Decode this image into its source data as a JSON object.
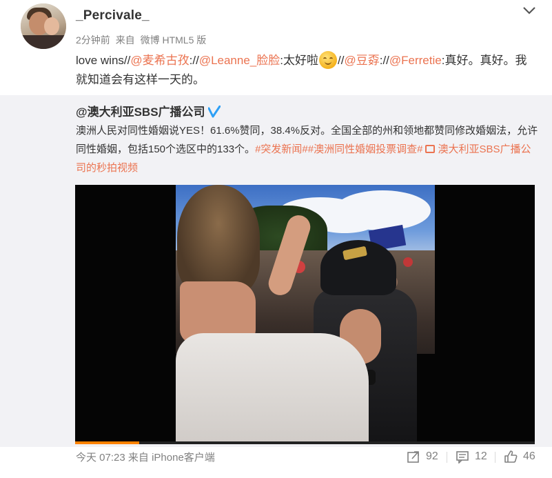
{
  "post": {
    "username": "_Percivale_",
    "meta": {
      "time": "2分钟前",
      "from_label": "来自",
      "source": "微博 HTML5 版"
    },
    "text": {
      "prefix": "love wins//",
      "mention1": "@麦希古孜",
      "sep1": "://",
      "mention2": "@Leanne_脸脸",
      "after2": ":太好啦",
      "sep2": "//",
      "mention3": "@豆孬",
      "sep3": "://",
      "mention4": "@Ferretie",
      "suffix": ":真好。真好。我就知道会有这样一天的。"
    }
  },
  "repost": {
    "author": "@澳大利亚SBS广播公司",
    "text_main": "澳洲人民对同性婚姻说YES！61.6%赞同，38.4%反对。全国全部的州和领地都赞同修改婚姻法，允许同性婚姻，包括150个选区中的133个。",
    "tag1": "#突发新闻#",
    "tag2": "#澳洲同性婚姻投票调查#",
    "video_link": "澳大利亚SBS广播公司的秒拍视频",
    "video": {
      "progress": 0.14
    },
    "footer": {
      "time": "今天 07:23",
      "from_label": "来自",
      "source": "iPhone客户端"
    },
    "stats": {
      "forward": "92",
      "comment": "12",
      "like": "46"
    }
  },
  "colors": {
    "accent": "#eb7350",
    "verified": "#2ea0f5",
    "progress": "#ff8200"
  },
  "icons": [
    "chevron-down-icon",
    "verified-badge-icon",
    "video-link-icon",
    "forward-icon",
    "comment-icon",
    "like-icon"
  ]
}
